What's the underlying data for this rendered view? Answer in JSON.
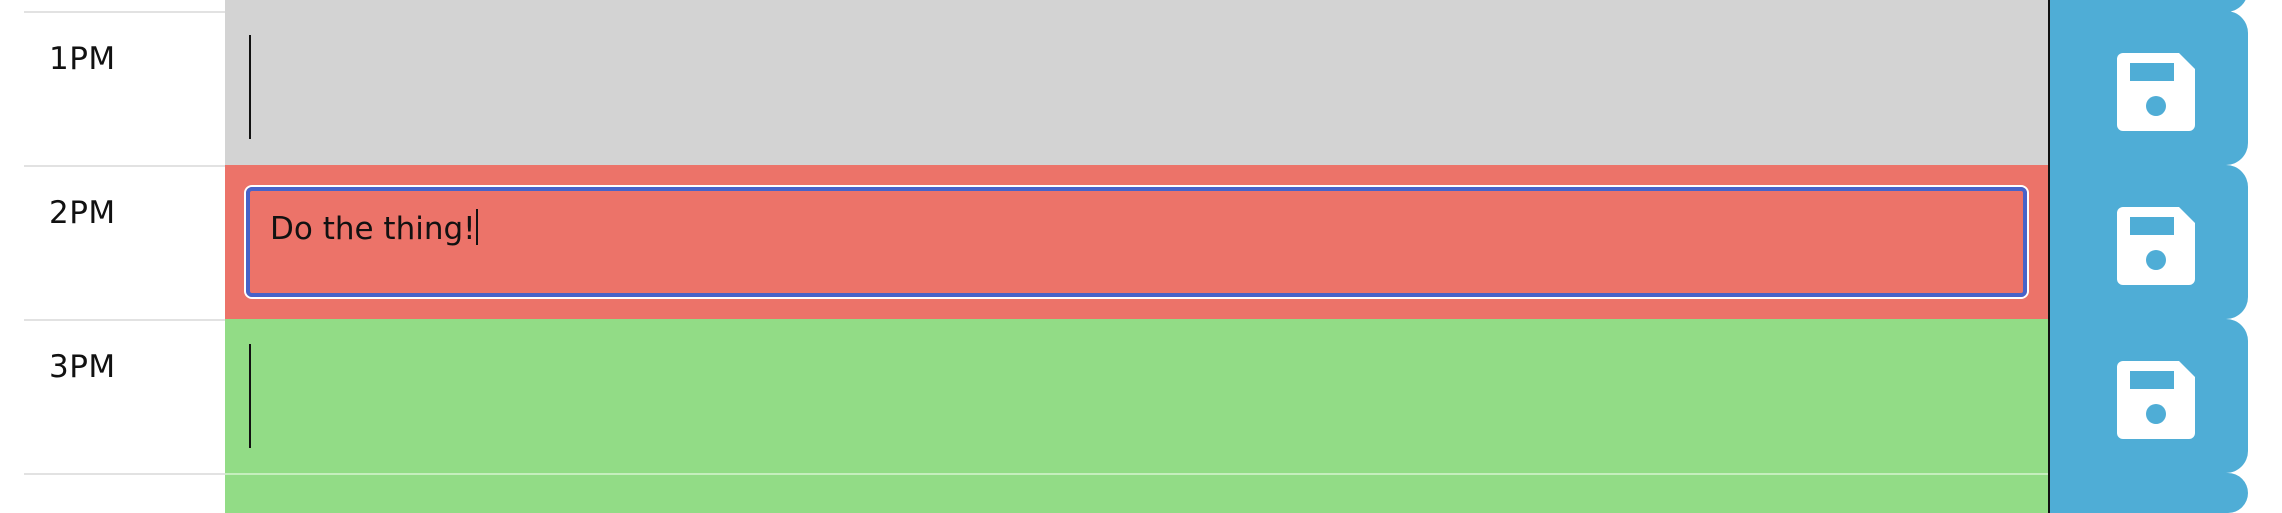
{
  "scheduler": {
    "rows": [
      {
        "hour": "",
        "status": "past",
        "description": ""
      },
      {
        "hour": "1PM",
        "status": "past",
        "description": ""
      },
      {
        "hour": "2PM",
        "status": "present",
        "description": "Do the thing!"
      },
      {
        "hour": "3PM",
        "status": "future",
        "description": ""
      },
      {
        "hour": "",
        "status": "future",
        "description": ""
      }
    ]
  },
  "icons": {
    "save": "floppy-disk-save-icon"
  },
  "colors": {
    "past": "#d3d3d3",
    "present": "#ec7369",
    "future": "#92dc86",
    "save_button": "#4fadd6",
    "focus_ring": "#4863c9"
  }
}
